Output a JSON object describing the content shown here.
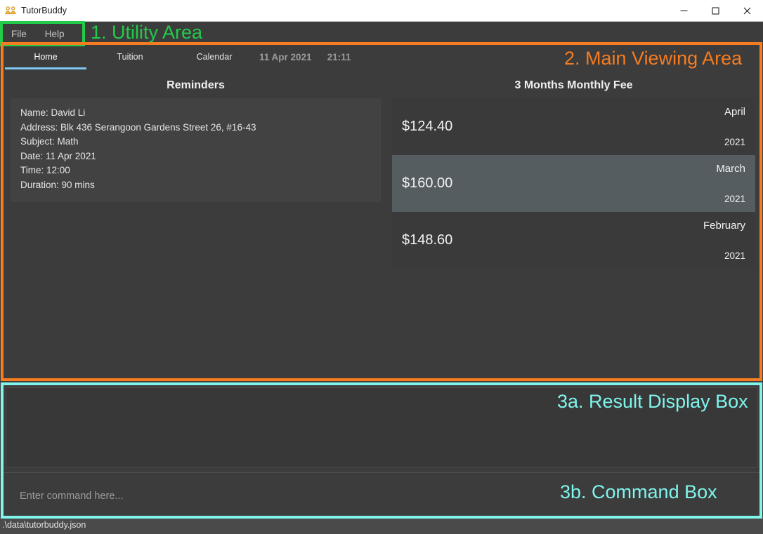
{
  "window": {
    "title": "TutorBuddy",
    "icon": "group-people-icon",
    "controls": {
      "minimize": "minimize-icon",
      "maximize": "maximize-icon",
      "close": "close-icon"
    }
  },
  "menubar": {
    "items": [
      {
        "label": "File"
      },
      {
        "label": "Help"
      }
    ]
  },
  "tabs": [
    {
      "label": "Home",
      "active": true
    },
    {
      "label": "Tuition",
      "active": false
    },
    {
      "label": "Calendar",
      "active": false
    }
  ],
  "clock": {
    "date": "11 Apr 2021",
    "time": "21:11"
  },
  "reminders": {
    "title": "Reminders",
    "lines": [
      "Name: David Li",
      "Address: Blk 436 Serangoon Gardens Street 26, #16-43",
      "Subject: Math",
      "Date: 11 Apr 2021",
      "Time: 12:00",
      "Duration: 90 mins"
    ]
  },
  "monthly_fee": {
    "title": "3 Months Monthly Fee",
    "rows": [
      {
        "amount": "$124.40",
        "month": "April",
        "year": "2021",
        "highlight": false
      },
      {
        "amount": "$160.00",
        "month": "March",
        "year": "2021",
        "highlight": true
      },
      {
        "amount": "$148.60",
        "month": "February",
        "year": "2021",
        "highlight": false
      }
    ]
  },
  "result_box": {
    "text": ""
  },
  "command_box": {
    "value": "",
    "placeholder": "Enter command here..."
  },
  "statusbar": {
    "path": ".\\data\\tutorbuddy.json"
  },
  "annotations": [
    {
      "id": "utility",
      "label": "1. Utility Area",
      "color": "#22cc4a"
    },
    {
      "id": "main",
      "label": "2. Main Viewing Area",
      "color": "#f57c20"
    },
    {
      "id": "result",
      "label": "3a. Result Display Box",
      "color": "#7ff5ec"
    },
    {
      "id": "command",
      "label": "3b. Command Box",
      "color": "#7ff5ec"
    }
  ]
}
